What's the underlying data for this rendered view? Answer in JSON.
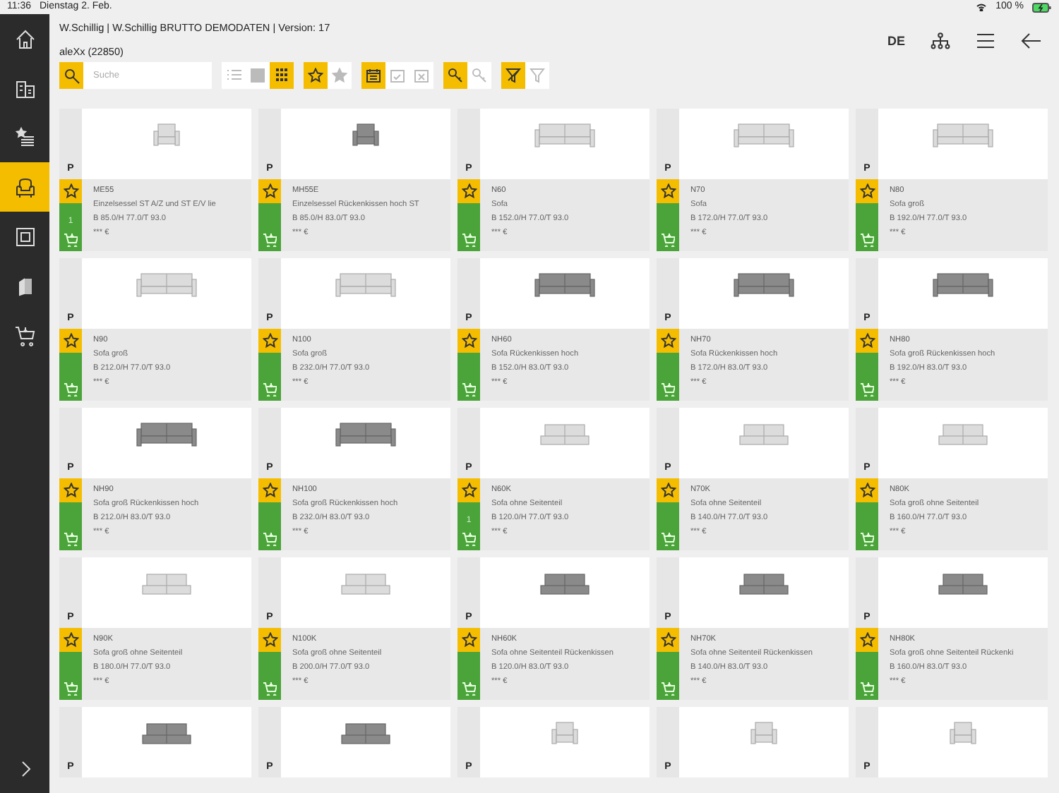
{
  "status_bar": {
    "time": "11:36",
    "date": "Dienstag 2. Feb.",
    "battery": "100 %"
  },
  "header": {
    "title": "W.Schillig | W.Schillig BRUTTO DEMODATEN | Version: 17",
    "user": "aleXx (22850)",
    "language": "DE"
  },
  "sidebar": {
    "items": [
      {
        "kind": "home",
        "selected": false
      },
      {
        "kind": "buildings",
        "selected": false
      },
      {
        "kind": "favorites",
        "selected": false
      },
      {
        "kind": "armchair",
        "selected": true
      },
      {
        "kind": "frame",
        "selected": false
      },
      {
        "kind": "swatches",
        "selected": false
      },
      {
        "kind": "cart",
        "selected": false
      }
    ]
  },
  "toolbar": {
    "search": {
      "placeholder": "Suche"
    },
    "groups": [
      [
        {
          "kind": "list",
          "selected": false
        },
        {
          "kind": "grid2",
          "selected": false
        },
        {
          "kind": "grid3",
          "selected": true
        }
      ],
      [
        {
          "kind": "star-outline",
          "selected": true
        },
        {
          "kind": "star-filled",
          "selected": false
        }
      ],
      [
        {
          "kind": "calendar",
          "selected": true
        },
        {
          "kind": "calendar-check",
          "selected": false
        },
        {
          "kind": "calendar-x",
          "selected": false
        }
      ],
      [
        {
          "kind": "key",
          "selected": true
        },
        {
          "kind": "key-off",
          "selected": false
        }
      ],
      [
        {
          "kind": "filter-x",
          "selected": true
        },
        {
          "kind": "filter",
          "selected": false
        }
      ]
    ]
  },
  "products": [
    {
      "kind": "armchair",
      "dark": false,
      "badge": "P",
      "favorite": false,
      "count": "1",
      "code": "ME55",
      "name": "Einzelsessel ST A/Z und ST E/V lie",
      "dims": "B 85.0/H 77.0/T 93.0",
      "price": "*** €"
    },
    {
      "kind": "armchair",
      "dark": true,
      "badge": "P",
      "favorite": false,
      "code": "MH55E",
      "name": "Einzelsessel Rückenkissen hoch ST",
      "dims": "B 85.0/H 83.0/T 93.0",
      "price": "*** €"
    },
    {
      "kind": "sofa",
      "dark": false,
      "badge": "P",
      "favorite": false,
      "code": "N60",
      "name": "Sofa",
      "dims": "B 152.0/H 77.0/T 93.0",
      "price": "*** €"
    },
    {
      "kind": "sofa",
      "dark": false,
      "badge": "P",
      "favorite": false,
      "code": "N70",
      "name": "Sofa",
      "dims": "B 172.0/H 77.0/T 93.0",
      "price": "*** €"
    },
    {
      "kind": "sofa",
      "dark": false,
      "badge": "P",
      "favorite": false,
      "code": "N80",
      "name": "Sofa groß",
      "dims": "B 192.0/H 77.0/T 93.0",
      "price": "*** €"
    },
    {
      "kind": "sofa",
      "dark": false,
      "badge": "P",
      "favorite": false,
      "code": "N90",
      "name": "Sofa groß",
      "dims": "B 212.0/H 77.0/T 93.0",
      "price": "*** €"
    },
    {
      "kind": "sofa",
      "dark": false,
      "badge": "P",
      "favorite": false,
      "code": "N100",
      "name": "Sofa groß",
      "dims": "B 232.0/H 77.0/T 93.0",
      "price": "*** €"
    },
    {
      "kind": "sofa",
      "dark": true,
      "badge": "P",
      "favorite": false,
      "code": "NH60",
      "name": "Sofa Rückenkissen hoch",
      "dims": "B 152.0/H 83.0/T 93.0",
      "price": "*** €"
    },
    {
      "kind": "sofa",
      "dark": true,
      "badge": "P",
      "favorite": false,
      "code": "NH70",
      "name": "Sofa Rückenkissen hoch",
      "dims": "B 172.0/H 83.0/T 93.0",
      "price": "*** €"
    },
    {
      "kind": "sofa",
      "dark": true,
      "badge": "P",
      "favorite": false,
      "code": "NH80",
      "name": "Sofa groß Rückenkissen hoch",
      "dims": "B 192.0/H 83.0/T 93.0",
      "price": "*** €"
    },
    {
      "kind": "sofa",
      "dark": true,
      "badge": "P",
      "favorite": false,
      "code": "NH90",
      "name": "Sofa groß Rückenkissen hoch",
      "dims": "B 212.0/H 83.0/T 93.0",
      "price": "*** €"
    },
    {
      "kind": "sofa",
      "dark": true,
      "badge": "P",
      "favorite": false,
      "code": "NH100",
      "name": "Sofa groß Rückenkissen hoch",
      "dims": "B 232.0/H 83.0/T 93.0",
      "price": "*** €"
    },
    {
      "kind": "module",
      "dark": false,
      "badge": "P",
      "favorite": false,
      "count": "1",
      "code": "N60K",
      "name": "Sofa ohne Seitenteil",
      "dims": "B 120.0/H 77.0/T 93.0",
      "price": "*** €"
    },
    {
      "kind": "module",
      "dark": false,
      "badge": "P",
      "favorite": false,
      "code": "N70K",
      "name": "Sofa ohne Seitenteil",
      "dims": "B 140.0/H 77.0/T 93.0",
      "price": "*** €"
    },
    {
      "kind": "module",
      "dark": false,
      "badge": "P",
      "favorite": false,
      "code": "N80K",
      "name": "Sofa groß ohne Seitenteil",
      "dims": "B 160.0/H 77.0/T 93.0",
      "price": "*** €"
    },
    {
      "kind": "module",
      "dark": false,
      "badge": "P",
      "favorite": false,
      "code": "N90K",
      "name": "Sofa groß ohne Seitenteil",
      "dims": "B 180.0/H 77.0/T 93.0",
      "price": "*** €"
    },
    {
      "kind": "module",
      "dark": false,
      "badge": "P",
      "favorite": false,
      "code": "N100K",
      "name": "Sofa groß ohne Seitenteil",
      "dims": "B 200.0/H 77.0/T 93.0",
      "price": "*** €"
    },
    {
      "kind": "module",
      "dark": true,
      "badge": "P",
      "favorite": false,
      "code": "NH60K",
      "name": "Sofa ohne Seitenteil Rückenkissen",
      "dims": "B 120.0/H 83.0/T 93.0",
      "price": "*** €"
    },
    {
      "kind": "module",
      "dark": true,
      "badge": "P",
      "favorite": false,
      "code": "NH70K",
      "name": "Sofa ohne Seitenteil Rückenkissen",
      "dims": "B 140.0/H 83.0/T 93.0",
      "price": "*** €"
    },
    {
      "kind": "module",
      "dark": true,
      "badge": "P",
      "favorite": false,
      "code": "NH80K",
      "name": "Sofa groß ohne Seitenteil Rückenki",
      "dims": "B 160.0/H 83.0/T 93.0",
      "price": "*** €"
    },
    {
      "kind": "module",
      "dark": true,
      "badge": "P"
    },
    {
      "kind": "module",
      "dark": true,
      "badge": "P"
    },
    {
      "kind": "armchair",
      "dark": false,
      "badge": "P"
    },
    {
      "kind": "armchair",
      "dark": false,
      "badge": "P"
    },
    {
      "kind": "armchair",
      "dark": false,
      "badge": "P"
    }
  ]
}
